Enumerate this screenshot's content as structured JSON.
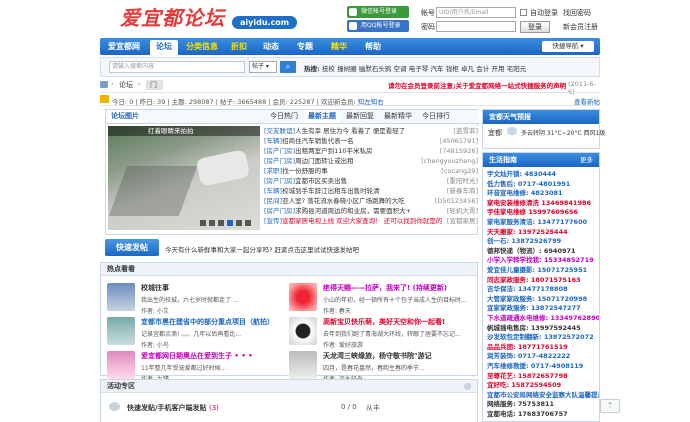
{
  "header": {
    "logo_text": "爱宜都论坛",
    "logo_domain": "aiyidu.com",
    "wechat_login": "微信帐号登录",
    "qq_login": "用QQ帐号登录",
    "account_label": "帐号",
    "account_placeholder": "UID/用户名/Email",
    "auto_login": "自动登录",
    "find_password": "找回密码",
    "password_label": "密码",
    "login_button": "登录",
    "register": "新会员注册"
  },
  "nav": {
    "items": [
      "爱宜都网",
      "论坛",
      "分类信息",
      "折扣",
      "动态",
      "专题",
      "精华",
      "帮助"
    ],
    "quick_nav": "快捷导航"
  },
  "search": {
    "placeholder": "请输入搜索内容",
    "scope": "帖子",
    "hot_label": "热搜:",
    "hot_terms": [
      "技校",
      "撞树圈",
      "幽默石头鸦",
      "空调",
      "电子琴",
      "汽车",
      "钱柜",
      "卓凡",
      "会计",
      "开用",
      "宅阳元"
    ]
  },
  "breadcrumb": {
    "home": "论坛",
    "current": "门"
  },
  "notice": "请勿在会员登录前注意;关于爱宜都网络一站式快捷服务的声明",
  "notice_date": "(2011-6-6)",
  "stats": {
    "today": "今日: 0",
    "yesterday": "昨日: 39",
    "posts": "主题: 298087",
    "total": "帖子: 3665488",
    "members": "会员: 225287",
    "welcome": "欢迎新会员:",
    "new_member": "知左知右",
    "link": "查看新帖"
  },
  "tabs": [
    "论坛图片",
    "今日热门",
    "最新主题",
    "最新回复",
    "最新精华",
    "今日排行"
  ],
  "slide_caption": "红着眼睛来拍拍",
  "threads": [
    {
      "tag": "[交友联谊]",
      "title": "人生有幸 居住为今 看着了 便是看轻了",
      "author": "[蓝雪菲]"
    },
    {
      "tag": "[车辆]",
      "title": "招商住汽车销售代表一名",
      "author": "[45061791]"
    },
    {
      "tag": "[房产门房]",
      "title": "出租两室户到110平米私房",
      "author": "[74815926]"
    },
    {
      "tag": "[房产门房]",
      "title": "周边门面转让或出租",
      "author": "[chengyouzheng]"
    },
    {
      "tag": "[求职]",
      "title": "找一份舒服的事",
      "author": "[cocang29]"
    },
    {
      "tag": "[房产门房]",
      "title": "宜都市区买卖出售",
      "author": "[重阳时光]"
    },
    {
      "tag": "[车辆]",
      "title": "校城到手车辞江出租车出售时轮清",
      "author": "[新春车商]"
    },
    {
      "tag": "[民间]",
      "title": "亚人室? 落花流水春晓小区广场跳舞的大吃",
      "author": "[D50123456]"
    },
    {
      "tag": "[房产门房]",
      "title": "求购县河道周边的和业房，需要面积大+",
      "author": "[轮机大哥]"
    },
    {
      "tag": "[宣传]",
      "title": "宣都家居电视上线 欢迎大家查询！ 还可以找到你就是的",
      "author": "[宣都家居]"
    }
  ],
  "quick_post": {
    "button": "快速发帖",
    "prompt": "今天有什么新鲜事和大家一起分享吗? 赶紧点击这里试试快速发帖吧"
  },
  "hot_section": {
    "title": "热点看看",
    "items": [
      {
        "title": "校城往事",
        "desc": "我出生的校城，六七岁时就都走了 ...",
        "author": "作者: 小艾"
      },
      {
        "title": "绝得天赐——拉萨，我来了! (持续更新)",
        "desc": "小山的年初，经一顿所有十个包子当成人生的目标时...",
        "author": "作者: 春天"
      },
      {
        "title": "宜都市黑在建省中的部分重点项目（航拍）",
        "desc": "记录宜都点滴! 。。。几年以后再看比...",
        "author": "作者: 小鸟"
      },
      {
        "title": "高新宝贝快乐萌，美好天空和你一起看!",
        "desc": "去年到我们跑了青海湖大环线，转眼了居要不忘记...",
        "author": "作者: 爱好旅游"
      },
      {
        "title": "爱宜都网日期奥丛在爱到生子 • • •",
        "desc": "11年整几年受宠爱都过好时候...",
        "author": "作者: 九瑾"
      },
      {
        "title": "天龙湾三峡缘旅，杨守敬书院\"游记",
        "desc": "四月，是春花盎然，春韵生春的季节...",
        "author": "作者: 流水轻舟"
      }
    ]
  },
  "activity": {
    "title": "活动专区",
    "item": "快速发贴/手机客户端发贴",
    "item_count": "(3)",
    "stat": "0 / 0",
    "from": "从丰"
  },
  "sidebar": {
    "weather_title": "宜都天气预报",
    "weather_city": "宜都",
    "weather_text": "多云转阴 31°C~20°C 西风1级",
    "life_title": "生活指南",
    "life_more": "更多",
    "life_items": [
      {
        "label": "宇文灿开锁:",
        "phone": "4830444",
        "color": "#1b66c3"
      },
      {
        "label": "低力售后:",
        "phone": "0717-4801991",
        "color": "#1b66c3"
      },
      {
        "label": "环音宣电维修:",
        "phone": "4823081",
        "color": "#1b66c3"
      },
      {
        "label": "家电安装维修清洗",
        "phone": "13469841986",
        "color": "#e0002a"
      },
      {
        "label": "宇佳家电维修",
        "phone": "15997609656",
        "color": "#e0002a"
      },
      {
        "label": "家电家服务清洁:",
        "phone": "13477177600",
        "color": "#1b66c3"
      },
      {
        "label": "天天搬家:",
        "phone": "13972525444",
        "color": "#e0002a"
      },
      {
        "label": "创一石:",
        "phone": "13872526799",
        "color": "#1b66c3"
      },
      {
        "label": "德邦快递（物流）:",
        "phone": "6940971",
        "color": "#333"
      },
      {
        "label": "小学入学转学找我:",
        "phone": "15334852719",
        "color": "#c000c0"
      },
      {
        "label": "爱宜佳儿童摄影:",
        "phone": "15071725951",
        "color": "#1b66c3"
      },
      {
        "label": "同志家政服务:",
        "phone": "18071575163",
        "color": "#e0002a"
      },
      {
        "label": "吉华保洁:",
        "phone": "13477178808",
        "color": "#1b66c3"
      },
      {
        "label": "大管家家政服务:",
        "phone": "15071720998",
        "color": "#1b66c3"
      },
      {
        "label": "宜家家政服务:",
        "phone": "13872547277",
        "color": "#1b66c3"
      },
      {
        "label": "下水道疏通水电维修:",
        "phone": "13349762890",
        "color": "#c000c0"
      },
      {
        "label": "帆城插电售房:",
        "phone": "13997592445",
        "color": "#333"
      },
      {
        "label": "沙发软包定制翻新:",
        "phone": "13872572072",
        "color": "#1b66c3"
      },
      {
        "label": "品品兵团:",
        "phone": "18771761519",
        "color": "#e0002a"
      },
      {
        "label": "润芳装饰:",
        "phone": "0717-4822222",
        "color": "#1b66c3"
      },
      {
        "label": "汽车维修救援:",
        "phone": "0717-4908119",
        "color": "#1b66c3"
      },
      {
        "label": "至尊花艺:",
        "phone": "15872657798",
        "color": "#e0002a"
      },
      {
        "label": "宜好吃:",
        "phone": "15872594509",
        "color": "#e0002a"
      },
      {
        "label": "宜都市公安局网络安全监察大队温馨提示",
        "phone": "",
        "color": "#1b66c3"
      },
      {
        "label": "网络服务:",
        "phone": "75753811",
        "color": "#333"
      },
      {
        "label": "宜都电话:",
        "phone": "17683706757",
        "color": "#333"
      }
    ]
  }
}
